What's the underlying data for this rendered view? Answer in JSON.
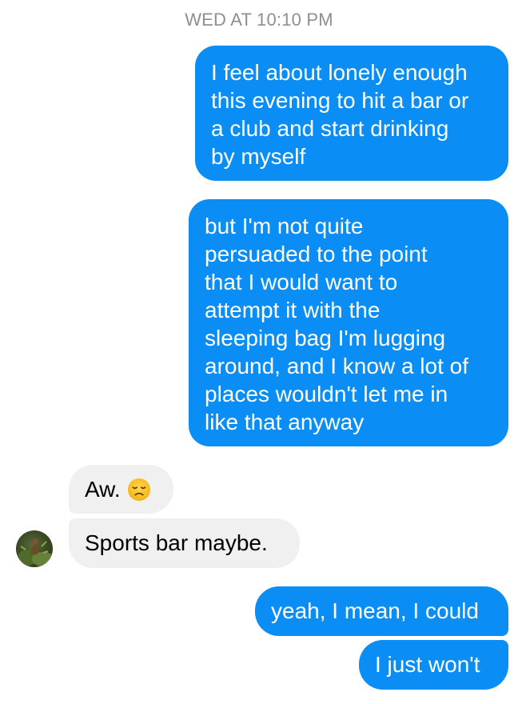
{
  "timestamp": "WED AT 10:10 PM",
  "messages": [
    {
      "direction": "outgoing",
      "lines": [
        "I feel about lonely enough",
        "this evening to hit a bar or",
        "a club and start drinking",
        "by myself"
      ]
    },
    {
      "direction": "outgoing",
      "lines": [
        "but I'm not quite",
        "persuaded to the point",
        "that I would want to",
        "attempt it with the",
        "sleeping bag I'm lugging",
        "around, and I know a lot of",
        "places wouldn't let me in",
        "like that anyway"
      ]
    },
    {
      "direction": "incoming",
      "text": "Aw.",
      "emoji": "disappointed-face-icon"
    },
    {
      "direction": "incoming",
      "text": "Sports bar maybe."
    },
    {
      "direction": "outgoing",
      "text": "yeah, I mean, I could"
    },
    {
      "direction": "outgoing",
      "text": "I just won't"
    }
  ],
  "contact": {
    "avatar_icon": "contact-avatar"
  },
  "colors": {
    "outgoing_bubble": "#0a8ef5",
    "incoming_bubble": "#f1f0f0",
    "timestamp_text": "#8e8e93"
  }
}
